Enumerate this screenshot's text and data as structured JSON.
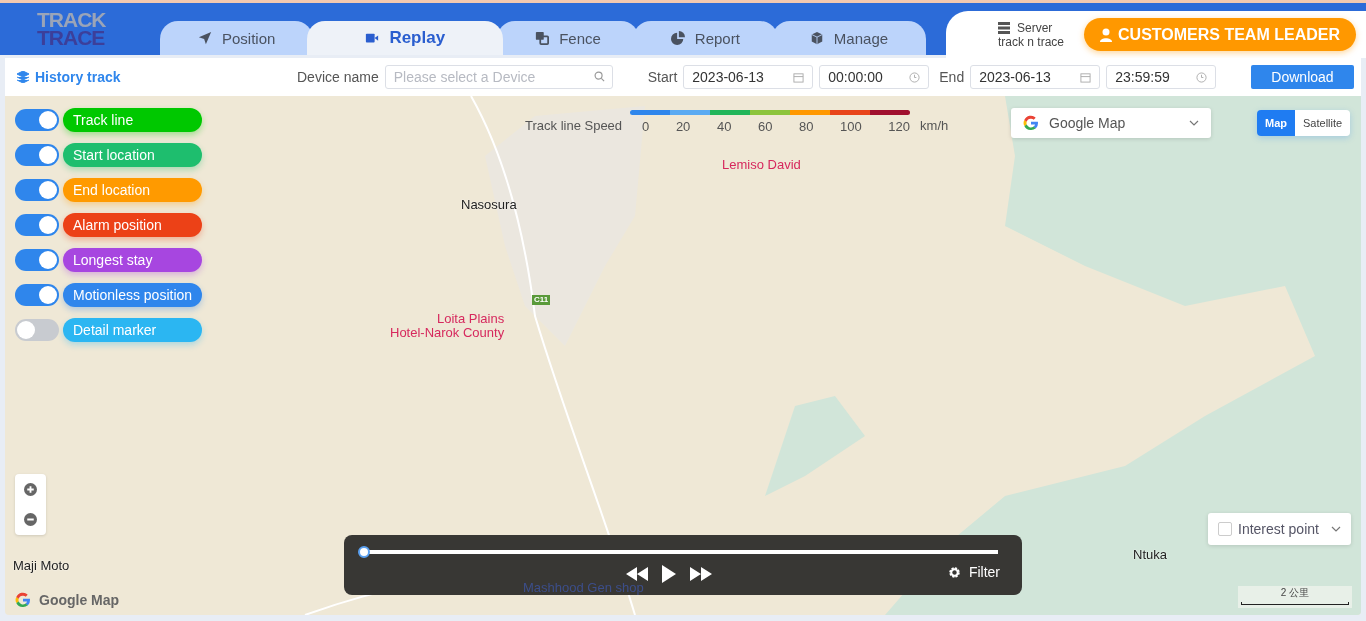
{
  "logo": {
    "line1": "TRACK",
    "line2": "TRACE"
  },
  "tabs": [
    {
      "label": "Position",
      "selected": false
    },
    {
      "label": "Replay",
      "selected": true
    },
    {
      "label": "Fence",
      "selected": false
    },
    {
      "label": "Report",
      "selected": false
    },
    {
      "label": "Manage",
      "selected": false
    }
  ],
  "server": {
    "label": "Server",
    "name": "track n trace"
  },
  "user_button": "CUSTOMERS TEAM LEADER",
  "toolbar": {
    "title": "History track",
    "device_label": "Device name",
    "device_placeholder": "Please select a Device",
    "start_label": "Start",
    "start_date": "2023-06-13",
    "start_time": "00:00:00",
    "end_label": "End",
    "end_date": "2023-06-13",
    "end_time": "23:59:59",
    "download": "Download"
  },
  "layers": [
    {
      "label": "Track line",
      "on": true,
      "color": "#00c800"
    },
    {
      "label": "Start location",
      "on": true,
      "color": "#1ebe6e"
    },
    {
      "label": "End location",
      "on": true,
      "color": "#ff9a00"
    },
    {
      "label": "Alarm position",
      "on": true,
      "color": "#ec4117"
    },
    {
      "label": "Longest stay",
      "on": true,
      "color": "#a746e0"
    },
    {
      "label": "Motionless position",
      "on": true,
      "color": "#2f86ec"
    },
    {
      "label": "Detail marker",
      "on": false,
      "color": "#2bb6f2"
    }
  ],
  "speed_legend": {
    "label": "Track line Speed",
    "unit": "km/h",
    "ticks": [
      "0",
      "20",
      "40",
      "60",
      "80",
      "100",
      "120"
    ],
    "segments": [
      {
        "color": "#2f86ec"
      },
      {
        "color": "#5aaaf2"
      },
      {
        "color": "#22b55a"
      },
      {
        "color": "#8cc43c"
      },
      {
        "color": "#ff9800"
      },
      {
        "color": "#e8441a"
      },
      {
        "color": "#a0102f"
      }
    ]
  },
  "map_type": "Google Map",
  "view_toggle": [
    {
      "label": "Map",
      "selected": true
    },
    {
      "label": "Satellite",
      "selected": false
    }
  ],
  "map_labels": [
    {
      "text": "Lemiso David",
      "kind": "poi"
    },
    {
      "text": "Nasosura",
      "kind": "place"
    },
    {
      "text": "C11",
      "kind": "road"
    },
    {
      "text": "Loita Plains\nHotel-Narok County",
      "kind": "poi"
    },
    {
      "text": "Maji Moto",
      "kind": "place"
    },
    {
      "text": "Ntuka",
      "kind": "place"
    },
    {
      "text": "Mashhood Gen shop",
      "kind": "shop"
    }
  ],
  "interest_point": {
    "label": "Interest point",
    "checked": false
  },
  "player": {
    "level": 0,
    "filter": "Filter"
  },
  "attribution": "Google Map",
  "scale": "2 公里"
}
